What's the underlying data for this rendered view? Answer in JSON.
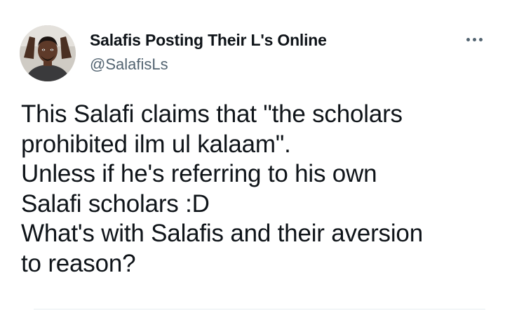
{
  "tweet": {
    "author": {
      "display_name": "Salafis Posting Their L's Online",
      "handle": "@SalafisLs",
      "avatar_icon": "profile-photo"
    },
    "more_icon": "more-options-icon",
    "text_lines": [
      "This Salafi claims that \"the scholars",
      "prohibited ilm ul kalaam\".",
      "Unless if he's referring to his own",
      "Salafi scholars :D",
      "What's with Salafis and their aversion",
      "to reason?"
    ]
  },
  "colors": {
    "text_primary": "#0f1419",
    "text_secondary": "#536471",
    "background": "#ffffff"
  }
}
